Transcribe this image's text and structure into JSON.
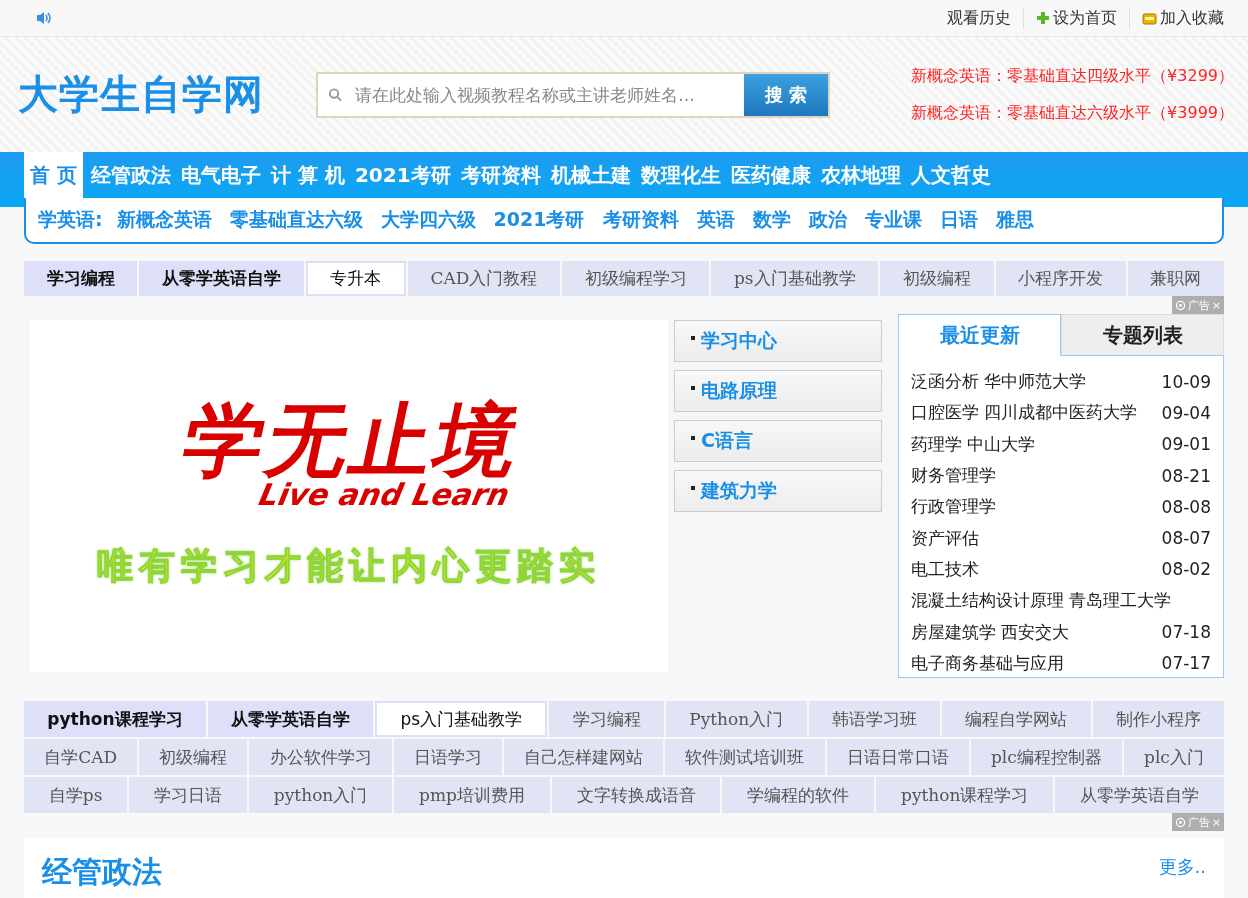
{
  "top_bar": {
    "links": [
      {
        "label": "观看历史",
        "kind": "plain"
      },
      {
        "label": "设为首页",
        "kind": "home"
      },
      {
        "label": "加入收藏",
        "kind": "favorite"
      }
    ]
  },
  "header": {
    "logo": "大学生自学网",
    "search": {
      "placeholder": "请在此处输入视频教程名称或主讲老师姓名…"
    },
    "search_button": "搜 索",
    "promos": [
      "新概念英语：零基础直达四级水平（¥3299）",
      "新概念英语：零基础直达六级水平（¥3999）"
    ]
  },
  "nav": {
    "items": [
      {
        "label": "首 页",
        "selected": true
      },
      {
        "label": "经管政法",
        "selected": false
      },
      {
        "label": "电气电子",
        "selected": false
      },
      {
        "label": "计 算 机",
        "selected": false
      },
      {
        "label": "2021考研",
        "selected": false
      },
      {
        "label": "考研资料",
        "selected": false
      },
      {
        "label": "机械土建",
        "selected": false
      },
      {
        "label": "数理化生",
        "selected": false
      },
      {
        "label": "医药健康",
        "selected": false
      },
      {
        "label": "农林地理",
        "selected": false
      },
      {
        "label": "人文哲史",
        "selected": false
      }
    ]
  },
  "sub_nav": {
    "label": "学英语:",
    "items": [
      "新概念英语",
      "零基础直达六级",
      "大学四六级",
      "2021考研",
      "考研资料",
      "英语",
      "数学",
      "政治",
      "专业课",
      "日语",
      "雅思"
    ]
  },
  "tag_strip": {
    "ad_label": "广告",
    "close": "×",
    "tags": [
      {
        "label": "学习编程",
        "kind": "bold"
      },
      {
        "label": "从零学英语自学",
        "kind": "bold"
      },
      {
        "label": "专升本",
        "kind": "white"
      },
      {
        "label": "CAD入门教程",
        "kind": "plain"
      },
      {
        "label": "初级编程学习",
        "kind": "plain"
      },
      {
        "label": "ps入门基础教学",
        "kind": "plain"
      },
      {
        "label": "初级编程",
        "kind": "plain"
      },
      {
        "label": "小程序开发",
        "kind": "plain"
      },
      {
        "label": "兼职网",
        "kind": "plain"
      }
    ]
  },
  "banner": {
    "title": "学无止境",
    "subtitle": "Live and Learn",
    "slogan": "唯有学习才能让内心更踏实"
  },
  "side_links": [
    "学习中心",
    "电路原理",
    "C语言",
    "建筑力学"
  ],
  "updates": {
    "tabs": [
      {
        "label": "最近更新",
        "selected": true
      },
      {
        "label": "专题列表",
        "selected": false
      }
    ],
    "items": [
      {
        "title": "泛函分析 华中师范大学",
        "date": "10-09"
      },
      {
        "title": "口腔医学 四川成都中医药大学",
        "date": "09-04"
      },
      {
        "title": "药理学 中山大学",
        "date": "09-01"
      },
      {
        "title": "财务管理学",
        "date": "08-21"
      },
      {
        "title": "行政管理学",
        "date": "08-08"
      },
      {
        "title": "资产评估",
        "date": "08-07"
      },
      {
        "title": "电工技术",
        "date": "08-02"
      },
      {
        "title": "混凝土结构设计原理 青岛理工大学"
      },
      {
        "title": "房屋建筑学 西安交大",
        "date": "07-18"
      },
      {
        "title": "电子商务基础与应用",
        "date": "07-17"
      }
    ]
  },
  "tag_grid": {
    "ad_label": "广告",
    "close": "×",
    "rows": [
      {
        "tags": [
          {
            "label": "python课程学习",
            "kind": "bold"
          },
          {
            "label": "从零学英语自学",
            "kind": "bold"
          },
          {
            "label": "ps入门基础教学",
            "kind": "white"
          },
          {
            "label": "学习编程",
            "kind": "plain"
          },
          {
            "label": "Python入门",
            "kind": "plain"
          },
          {
            "label": "韩语学习班",
            "kind": "plain"
          },
          {
            "label": "编程自学网站",
            "kind": "plain"
          },
          {
            "label": "制作小程序",
            "kind": "plain"
          }
        ]
      },
      {
        "tags": [
          {
            "label": "自学CAD",
            "kind": "plain"
          },
          {
            "label": "初级编程",
            "kind": "plain"
          },
          {
            "label": "办公软件学习",
            "kind": "plain"
          },
          {
            "label": "日语学习",
            "kind": "plain"
          },
          {
            "label": "自己怎样建网站",
            "kind": "plain"
          },
          {
            "label": "软件测试培训班",
            "kind": "plain"
          },
          {
            "label": "日语日常口语",
            "kind": "plain"
          },
          {
            "label": "plc编程控制器",
            "kind": "plain"
          },
          {
            "label": "plc入门",
            "kind": "plain"
          }
        ]
      },
      {
        "tags": [
          {
            "label": "自学ps",
            "kind": "plain"
          },
          {
            "label": "学习日语",
            "kind": "plain"
          },
          {
            "label": "python入门",
            "kind": "plain"
          },
          {
            "label": "pmp培训费用",
            "kind": "plain"
          },
          {
            "label": "文字转换成语音",
            "kind": "plain"
          },
          {
            "label": "学编程的软件",
            "kind": "plain"
          },
          {
            "label": "python课程学习",
            "kind": "plain"
          },
          {
            "label": "从零学英语自学",
            "kind": "plain"
          }
        ]
      }
    ]
  },
  "section": {
    "title": "经管政法",
    "more": "更多.."
  }
}
